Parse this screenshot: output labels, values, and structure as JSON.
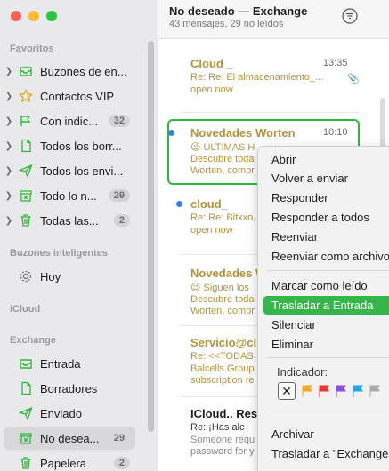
{
  "window": {
    "title": "No deseado — Exchange",
    "subtitle": "43 mensajes, 29 no leídos"
  },
  "sidebar": {
    "favoritos_title": "Favoritos",
    "favoritos": [
      {
        "label": "Buzones de en...",
        "icon": "tray-icon",
        "badge": ""
      },
      {
        "label": "Contactos VIP",
        "icon": "star-icon",
        "badge": ""
      },
      {
        "label": "Con indic...",
        "icon": "flag-icon",
        "badge": "32"
      },
      {
        "label": "Todos los borr...",
        "icon": "doc-icon",
        "badge": ""
      },
      {
        "label": "Todos los envi...",
        "icon": "paperplane-icon",
        "badge": ""
      },
      {
        "label": "Todo lo n...",
        "icon": "junk-icon",
        "badge": "29"
      },
      {
        "label": "Todas las...",
        "icon": "trash-icon",
        "badge": "2"
      }
    ],
    "inteligentes_title": "Buzones inteligentes",
    "inteligentes": [
      {
        "label": "Hoy",
        "icon": "gear-icon"
      }
    ],
    "icloud_title": "iCloud",
    "exchange_title": "Exchange",
    "exchange": [
      {
        "label": "Entrada",
        "icon": "tray-icon",
        "badge": ""
      },
      {
        "label": "Borradores",
        "icon": "doc-icon",
        "badge": ""
      },
      {
        "label": "Enviado",
        "icon": "paperplane-icon",
        "badge": ""
      },
      {
        "label": "No desea...",
        "icon": "junk-icon",
        "badge": "29"
      },
      {
        "label": "Papelera",
        "icon": "trash-icon",
        "badge": "2"
      }
    ]
  },
  "messages": [
    {
      "from": "Cloud _",
      "time": "13:35",
      "subject": "Re: Re: El almacenamiento_...",
      "preview": "open now",
      "unread": false
    },
    {
      "from": "Novedades Worten",
      "time": "10:10",
      "subject": "😉 ÚLTIMAS H",
      "preview": "Descubre toda\nWorten, compr",
      "unread": true
    },
    {
      "from": "cloud_",
      "time": "",
      "subject": "Re: Re: Bitxxo, ",
      "preview": "open now",
      "unread": true
    },
    {
      "from": "Novedades W",
      "time": "",
      "subject": "😉 Siguen los",
      "preview": "Descubre toda\nWorten, compr",
      "unread": false
    },
    {
      "from": "Servicio@cl",
      "time": "",
      "subject": "Re: <<TODAS",
      "preview": "Balcells Group\nsubscription re",
      "unread": false
    },
    {
      "from": "ICloud.. Res",
      "time": "",
      "subject": "Re: ¡Has alc",
      "preview": "Someone requ\npassword for y",
      "unread": false
    }
  ],
  "context_menu": {
    "items": [
      "Abrir",
      "Volver a enviar",
      "Responder",
      "Responder a todos",
      "Reenviar",
      "Reenviar como archivo",
      "Marcar como leído",
      "Trasladar a Entrada",
      "Silenciar",
      "Eliminar",
      "Archivar",
      "Trasladar a \"Exchange"
    ],
    "indicador_label": "Indicador:",
    "flag_colors": [
      "#f5a623",
      "#f0302e",
      "#8a4fe0",
      "#1aa7f0",
      "#aaaaaa"
    ],
    "highlight_color": "#36b64a"
  },
  "colors": {
    "selection_border": "#2eb83b",
    "unread_dot": "#2f7ff6",
    "sender_color": "#b4933a"
  }
}
